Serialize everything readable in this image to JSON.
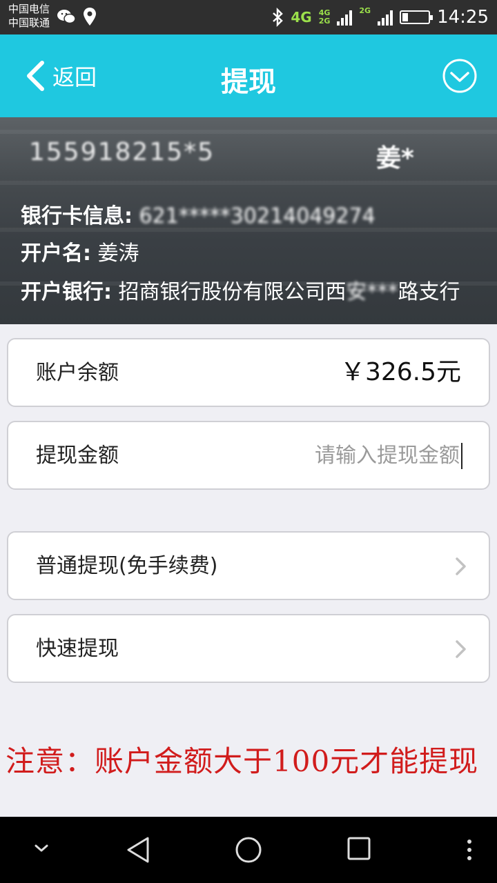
{
  "status_bar": {
    "carrier_1": "中国电信",
    "carrier_2": "中国联通",
    "network_1": "4G",
    "network_2_top": "4G",
    "network_2_bottom": "2G",
    "network_3": "2G",
    "time": "14:25",
    "icons": [
      "wechat-icon",
      "location-icon",
      "bluetooth-icon",
      "signal-icon",
      "battery-icon"
    ]
  },
  "header": {
    "back_label": "返回",
    "title": "提现",
    "accent_color": "#1fc8e0"
  },
  "account_info": {
    "phone": "155918215*5",
    "user_name": "姜*",
    "bank_card_label": "银行卡信息:",
    "bank_card_value": "621*****30214049274",
    "holder_label": "开户名:",
    "holder_value": "姜涛",
    "bank_label": "开户银行:",
    "bank_value_prefix": "招商银行股份有限公司西",
    "bank_value_blurred": "安***",
    "bank_value_suffix": "路支行"
  },
  "balance": {
    "label": "账户余额",
    "value": "￥326.5元"
  },
  "withdraw_amount": {
    "label": "提现金额",
    "placeholder": "请输入提现金额"
  },
  "options": [
    {
      "label": "普通提现(免手续费)"
    },
    {
      "label": "快速提现"
    }
  ],
  "notice": {
    "text": "注意：账户金额大于100元才能提现",
    "color": "#d11c1c"
  },
  "nav": {
    "icons": [
      "collapse-icon",
      "back-triangle-icon",
      "home-circle-icon",
      "recents-square-icon",
      "more-icon"
    ]
  }
}
